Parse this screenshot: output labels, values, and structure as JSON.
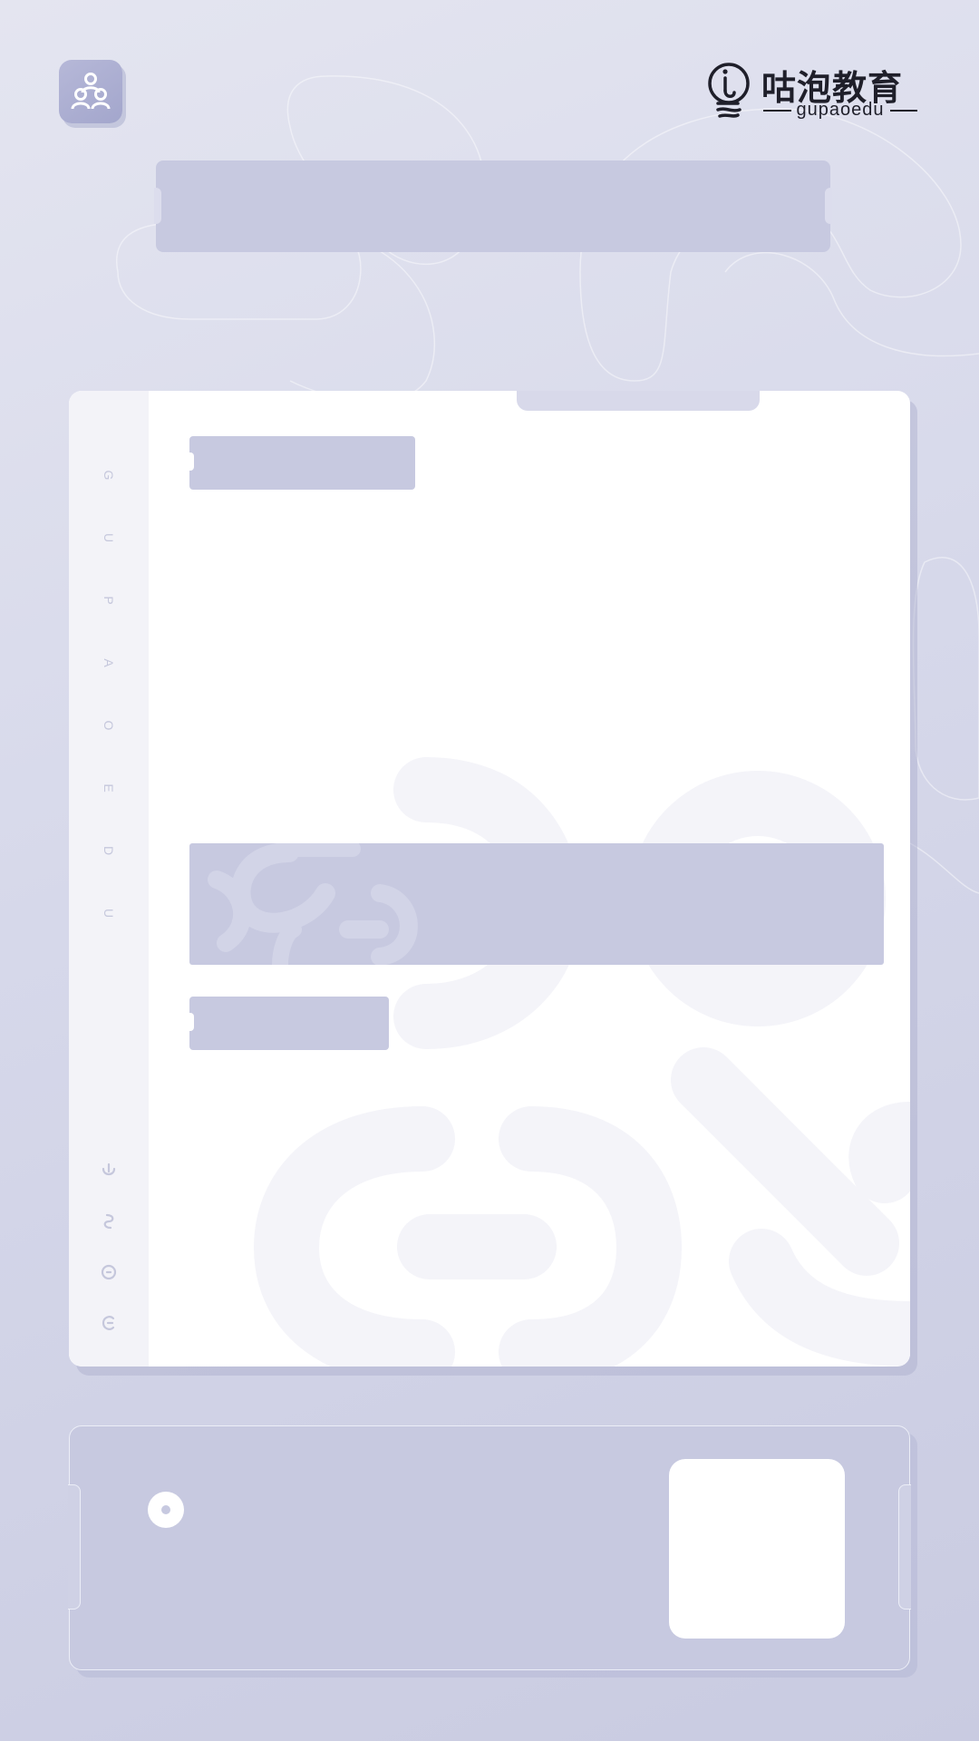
{
  "brand": {
    "name_cn": "咕泡教育",
    "name_en": "gupaoedu"
  },
  "header": {
    "team_icon": "team-icon",
    "logo_icon": "lightbulb-logo-icon"
  },
  "sidebar": {
    "letters": [
      "G",
      "U",
      "P",
      "A",
      "O",
      "E",
      "D",
      "U"
    ],
    "icons": [
      "g-glyph-icon",
      "u-glyph-icon",
      "p-glyph-icon",
      "a-glyph-icon"
    ]
  },
  "colors": {
    "background": "#d6d8ea",
    "placeholder": "#c7c9e0",
    "card": "#ffffff",
    "accent_text": "#1f1f2a"
  }
}
